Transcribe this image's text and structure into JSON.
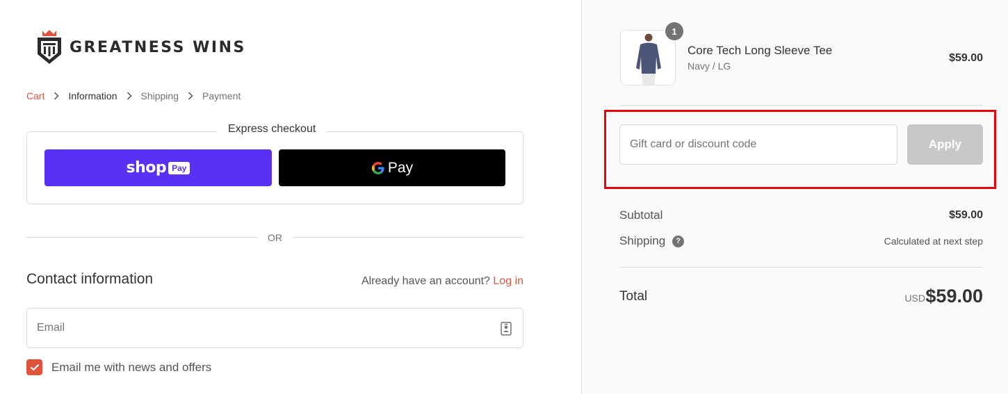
{
  "brand": {
    "name": "GREATNESS WINS",
    "logo_icon": "shield-crown-logo"
  },
  "breadcrumb": [
    {
      "label": "Cart",
      "state": "link"
    },
    {
      "label": "Information",
      "state": "current"
    },
    {
      "label": "Shipping",
      "state": "upcoming"
    },
    {
      "label": "Payment",
      "state": "upcoming"
    }
  ],
  "express": {
    "title": "Express checkout",
    "shop_pay": {
      "word": "shop",
      "pay": "Pay"
    },
    "google_pay": {
      "g": "G",
      "pay": "Pay"
    }
  },
  "divider": {
    "or": "OR"
  },
  "contact": {
    "title": "Contact information",
    "account_prompt": "Already have an account?",
    "login_link": "Log in",
    "email_placeholder": "Email",
    "newsletter_label": "Email me with news and offers",
    "newsletter_checked": true
  },
  "cart": {
    "item": {
      "quantity": "1",
      "name": "Core Tech Long Sleeve Tee",
      "variant": "Navy / LG",
      "price": "$59.00"
    },
    "discount": {
      "placeholder": "Gift card or discount code",
      "apply_label": "Apply"
    },
    "summary": {
      "subtotal_label": "Subtotal",
      "subtotal_value": "$59.00",
      "shipping_label": "Shipping",
      "shipping_value": "Calculated at next step",
      "total_label": "Total",
      "total_currency": "USD",
      "total_value": "$59.00"
    }
  },
  "colors": {
    "accent": "#e0533b",
    "shop_pay": "#5a31f4",
    "google_pay_bg": "#000000",
    "apply_disabled": "#c8c8c8",
    "highlight_box": "#e8000b"
  }
}
